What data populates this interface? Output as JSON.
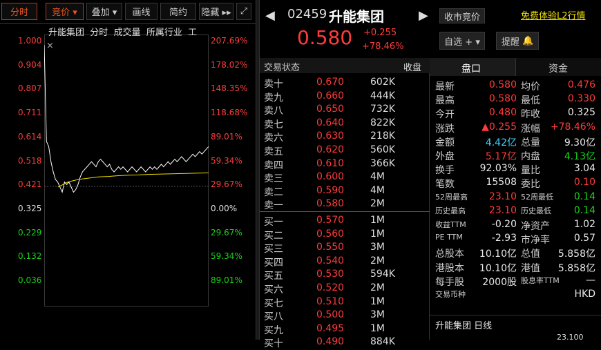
{
  "toolbar": {
    "tabs": [
      "分时",
      "竞价 ▾",
      "叠加 ▾",
      "画线",
      "简约",
      "隐藏 ▸▸"
    ],
    "expand_icon": "expand-icon"
  },
  "chart": {
    "legend": [
      "升能集团",
      "分时",
      "成交量",
      "所属行业",
      "工"
    ],
    "y_left": [
      "1.000",
      "0.904",
      "0.807",
      "0.711",
      "0.614",
      "0.518",
      "0.421",
      "0.325",
      "0.229",
      "0.132",
      "0.036"
    ],
    "y_right": [
      "207.69%",
      "178.02%",
      "148.35%",
      "118.68%",
      "89.01%",
      "59.34%",
      "29.67%",
      "0.00%",
      "29.67%",
      "59.34%",
      "89.01%"
    ]
  },
  "chart_data": {
    "type": "line",
    "ylim": [
      0.036,
      1.0
    ],
    "prev_close": 0.325,
    "series": [
      {
        "values": [
          0.98,
          0.6,
          0.58,
          0.52,
          0.48,
          0.45,
          0.44,
          0.42,
          0.4,
          0.44,
          0.43,
          0.44,
          0.42,
          0.4,
          0.41,
          0.43,
          0.46,
          0.48,
          0.49,
          0.5,
          0.51,
          0.52,
          0.51,
          0.5,
          0.52,
          0.53,
          0.52,
          0.51,
          0.5,
          0.51,
          0.49,
          0.48,
          0.49,
          0.5,
          0.49,
          0.5,
          0.49,
          0.48,
          0.49,
          0.5,
          0.49,
          0.48,
          0.49,
          0.5,
          0.49,
          0.48,
          0.49,
          0.5,
          0.49,
          0.5,
          0.49,
          0.5,
          0.51,
          0.5,
          0.51,
          0.52,
          0.51,
          0.52,
          0.53,
          0.52,
          0.53,
          0.54,
          0.53,
          0.52,
          0.53,
          0.54,
          0.55,
          0.54,
          0.55,
          0.56,
          0.55,
          0.56,
          0.57,
          0.58
        ]
      },
      {
        "values": [
          0.42,
          0.44,
          0.45,
          0.455,
          0.46,
          0.462,
          0.465,
          0.467,
          0.468,
          0.47,
          0.471,
          0.472,
          0.473,
          0.474,
          0.475,
          0.476
        ]
      }
    ]
  },
  "header": {
    "code": "02459",
    "name": "升能集团",
    "price": "0.580",
    "change": "+0.255",
    "change_pct": "+78.46%",
    "status_btn": "收市竞价",
    "watch_btn": "自选 + ▾",
    "alert_btn": "提醒",
    "l2_link": "免费体验L2行情"
  },
  "orderbook": {
    "title": "交易状态",
    "status": "收盘",
    "sells": [
      [
        "卖十",
        "0.670",
        "602K"
      ],
      [
        "卖九",
        "0.660",
        "444K"
      ],
      [
        "卖八",
        "0.650",
        "732K"
      ],
      [
        "卖七",
        "0.640",
        "822K"
      ],
      [
        "卖六",
        "0.630",
        "218K"
      ],
      [
        "卖五",
        "0.620",
        "560K"
      ],
      [
        "卖四",
        "0.610",
        "366K"
      ],
      [
        "卖三",
        "0.600",
        "4M"
      ],
      [
        "卖二",
        "0.590",
        "4M"
      ],
      [
        "卖一",
        "0.580",
        "2M"
      ]
    ],
    "buys": [
      [
        "买一",
        "0.570",
        "1M"
      ],
      [
        "买二",
        "0.560",
        "1M"
      ],
      [
        "买三",
        "0.550",
        "3M"
      ],
      [
        "买四",
        "0.540",
        "2M"
      ],
      [
        "买五",
        "0.530",
        "594K"
      ],
      [
        "买六",
        "0.520",
        "2M"
      ],
      [
        "买七",
        "0.510",
        "1M"
      ],
      [
        "买八",
        "0.500",
        "3M"
      ],
      [
        "买九",
        "0.495",
        "1M"
      ],
      [
        "买十",
        "0.490",
        "884K"
      ]
    ]
  },
  "panel": {
    "tabs": [
      "盘口",
      "资金"
    ]
  },
  "quote": [
    {
      "l": "最新",
      "v": "0.580",
      "vc": "red",
      "l2": "均价",
      "v2": "0.476",
      "v2c": "red"
    },
    {
      "l": "最高",
      "v": "0.580",
      "vc": "red",
      "l2": "最低",
      "v2": "0.330",
      "v2c": "red"
    },
    {
      "l": "今开",
      "v": "0.480",
      "vc": "red",
      "l2": "昨收",
      "v2": "0.325",
      "v2c": "wht"
    },
    {
      "l": "涨跌",
      "v": "▲0.255",
      "vc": "red",
      "l2": "涨幅",
      "v2": "+78.46%",
      "v2c": "red"
    },
    {
      "l": "金额",
      "v": "4.42亿",
      "vc": "cy",
      "l2": "总量",
      "v2": "9.30亿",
      "v2c": "wht"
    },
    {
      "l": "外盘",
      "v": "5.17亿",
      "vc": "red",
      "l2": "内盘",
      "v2": "4.13亿",
      "v2c": "grn"
    },
    {
      "l": "换手",
      "v": "92.03%",
      "vc": "wht",
      "l2": "量比",
      "v2": "3.04",
      "v2c": "wht"
    },
    {
      "l": "笔数",
      "v": "15508",
      "vc": "wht",
      "l2": "委比",
      "v2": "0.10",
      "v2c": "red"
    },
    {
      "l": "52周最高",
      "v": "23.10",
      "vc": "red",
      "l2": "52周最低",
      "v2": "0.14",
      "v2c": "grn"
    },
    {
      "l": "历史最高",
      "v": "23.10",
      "vc": "red",
      "l2": "历史最低",
      "v2": "0.14",
      "v2c": "grn"
    },
    {
      "l": "收益TTM",
      "v": "-0.20",
      "vc": "wht",
      "l2": "净资产",
      "v2": "1.02",
      "v2c": "wht"
    },
    {
      "l": "PE TTM",
      "v": "-2.93",
      "vc": "wht",
      "l2": "市净率",
      "v2": "0.57",
      "v2c": "wht"
    },
    {
      "l": "总股本",
      "v": "10.10亿",
      "vc": "wht",
      "l2": "总值",
      "v2": "5.858亿",
      "v2c": "wht"
    },
    {
      "l": "港股本",
      "v": "10.10亿",
      "vc": "wht",
      "l2": "港值",
      "v2": "5.858亿",
      "v2c": "wht"
    },
    {
      "l": "每手股",
      "v": "2000股",
      "vc": "wht",
      "l2": "股息率TTM",
      "v2": "—",
      "v2c": "wht"
    },
    {
      "l": "交易币种",
      "v": "",
      "vc": "wht",
      "l2": "",
      "v2": "HKD",
      "v2c": "wht"
    }
  ],
  "bottom": {
    "label": "升能集团 日线",
    "value": "23.100"
  },
  "colors": {
    "up": "#ff3b3b",
    "down": "#19d419",
    "price_line": "#ffffff",
    "avg_line": "#f0e000",
    "accent": "#e5541f"
  }
}
